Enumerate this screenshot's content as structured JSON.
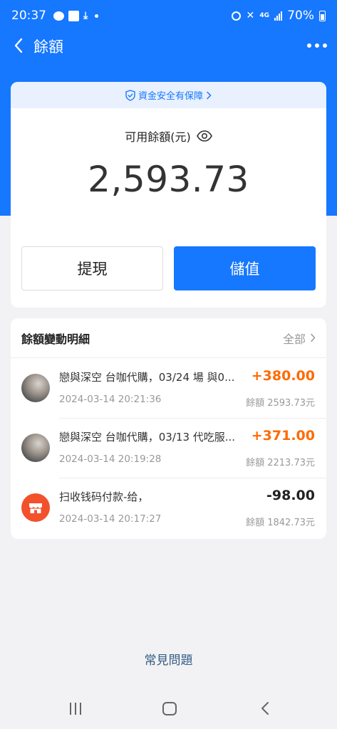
{
  "status_bar": {
    "time": "20:37",
    "network": "4G",
    "battery": "70%"
  },
  "nav": {
    "title": "餘額"
  },
  "balance_card": {
    "security_text": "資金安全有保障",
    "balance_label": "可用餘額(元)",
    "balance_amount": "2,593.73",
    "withdraw_label": "提現",
    "topup_label": "儲值"
  },
  "transactions": {
    "title": "餘額變動明細",
    "all_label": "全部",
    "items": [
      {
        "description": "戀與深空 台咖代購，03/24 場 與0...",
        "time": "2024-03-14 20:21:36",
        "amount": "+380.00",
        "balance": "餘額 2593.73元"
      },
      {
        "description": "戀與深空 台咖代購，03/13 代吃服...",
        "time": "2024-03-14 20:19:28",
        "amount": "+371.00",
        "balance": "餘額 2213.73元"
      },
      {
        "description": "扫收钱码付款-给，",
        "time": "2024-03-14 20:17:27",
        "amount": "-98.00",
        "balance": "餘額 1842.73元"
      }
    ]
  },
  "faq_label": "常見問題",
  "colors": {
    "primary": "#1677ff",
    "income": "#ff6a00",
    "store_icon": "#f2512b"
  }
}
